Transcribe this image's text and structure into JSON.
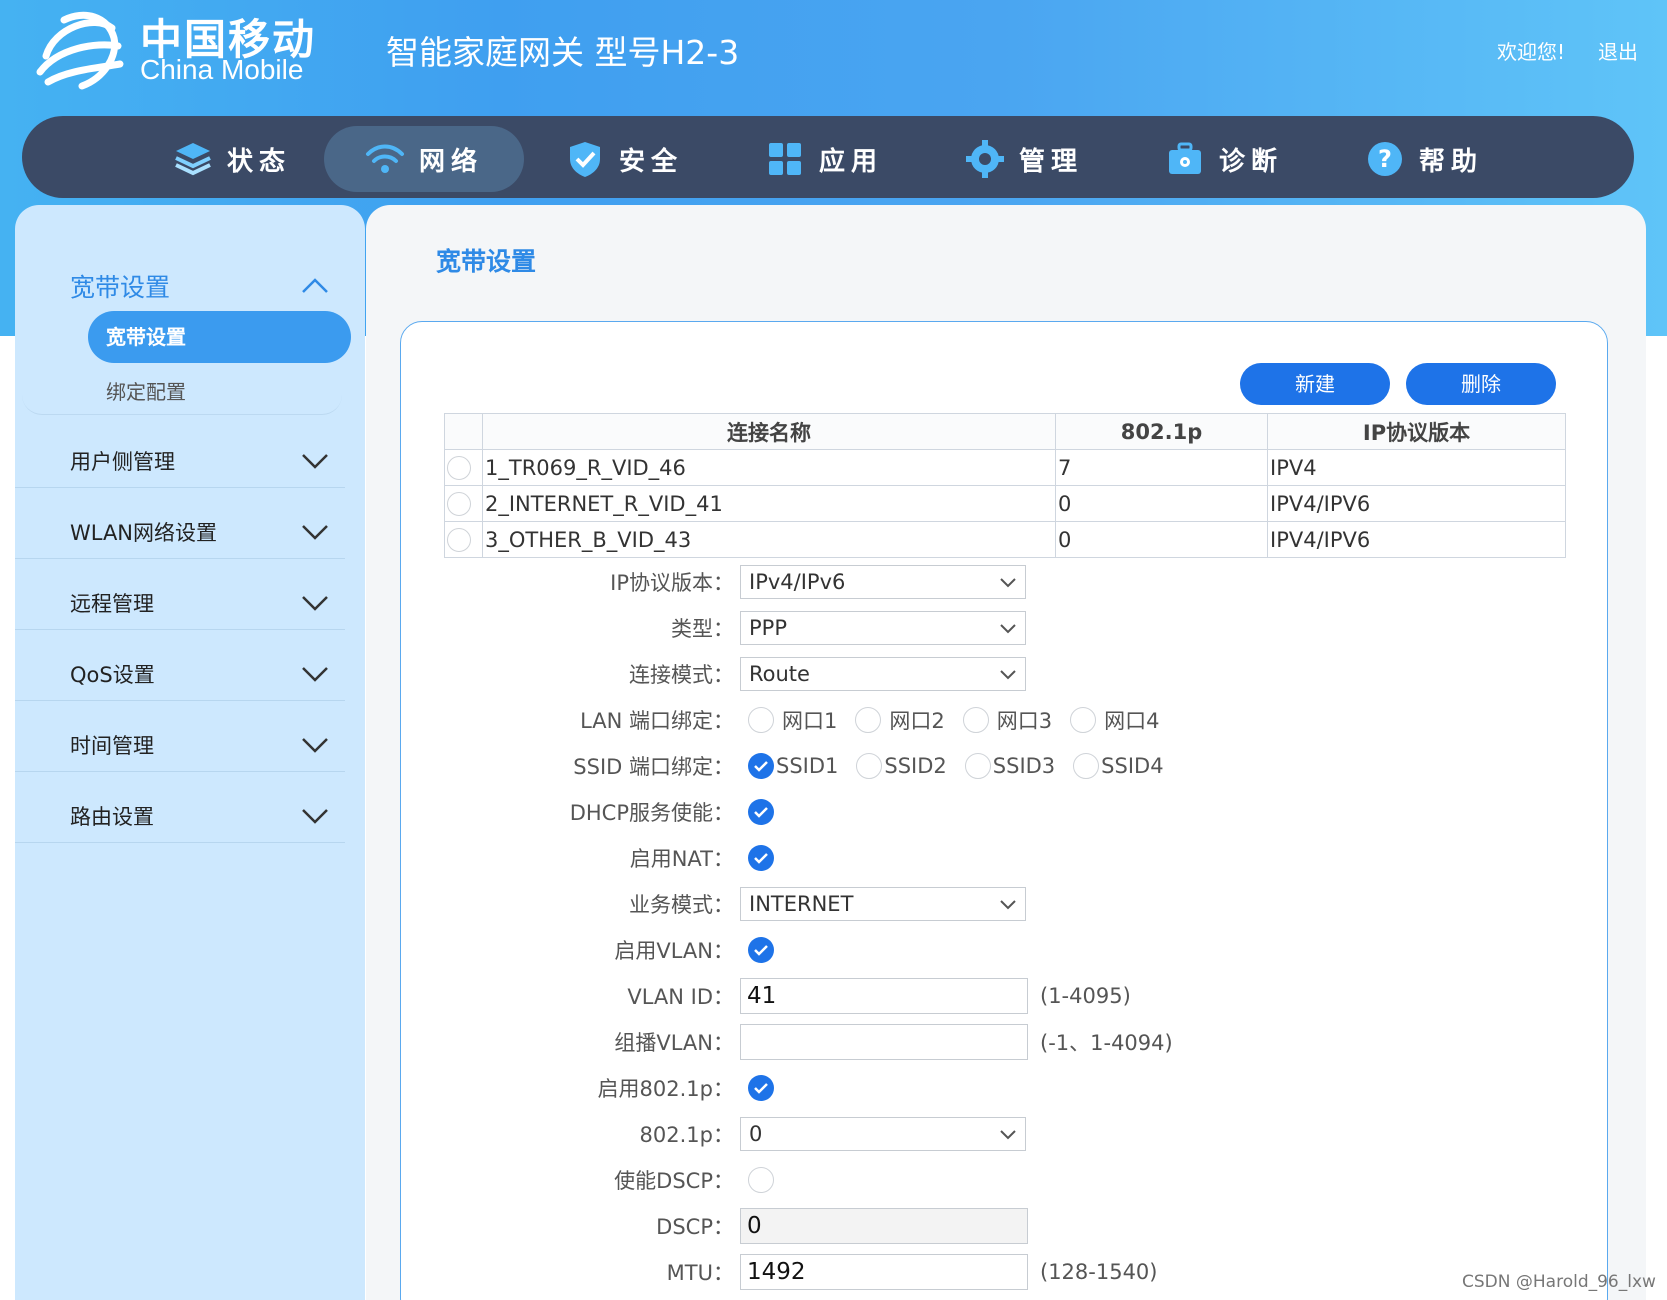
{
  "header": {
    "logo_cn": "中国移动",
    "logo_en": "China Mobile",
    "product": "智能家庭网关 型号H2-3",
    "welcome": "欢迎您!",
    "logout": "退出"
  },
  "nav": [
    {
      "label": "状态",
      "icon": "layers-icon"
    },
    {
      "label": "网络",
      "icon": "wifi-icon",
      "active": true
    },
    {
      "label": "安全",
      "icon": "shield-icon"
    },
    {
      "label": "应用",
      "icon": "grid-icon"
    },
    {
      "label": "管理",
      "icon": "gear-icon"
    },
    {
      "label": "诊断",
      "icon": "toolbox-icon"
    },
    {
      "label": "帮助",
      "icon": "help-icon"
    }
  ],
  "sidebar": {
    "open_group": "宽带设置",
    "sub_items": [
      "宽带设置",
      "绑定配置"
    ],
    "groups": [
      "用户侧管理",
      "WLAN网络设置",
      "远程管理",
      "QoS设置",
      "时间管理",
      "路由设置"
    ]
  },
  "main": {
    "title": "宽带设置",
    "new_button": "新建",
    "delete_button": "删除"
  },
  "table": {
    "headers": [
      "连接名称",
      "802.1p",
      "IP协议版本"
    ],
    "rows": [
      [
        "1_TR069_R_VID_46",
        "7",
        "IPV4"
      ],
      [
        "2_INTERNET_R_VID_41",
        "0",
        "IPV4/IPV6"
      ],
      [
        "3_OTHER_B_VID_43",
        "0",
        "IPV4/IPV6"
      ]
    ]
  },
  "form": {
    "ip_version": {
      "label": "IP协议版本：",
      "value": "IPv4/IPv6"
    },
    "type": {
      "label": "类型：",
      "value": "PPP"
    },
    "conn_mode": {
      "label": "连接模式：",
      "value": "Route"
    },
    "lan_bind": {
      "label": "LAN 端口绑定：",
      "options": [
        "网口1",
        "网口2",
        "网口3",
        "网口4"
      ]
    },
    "ssid_bind": {
      "label": "SSID 端口绑定：",
      "options": [
        "SSID1",
        "SSID2",
        "SSID3",
        "SSID4"
      ]
    },
    "dhcp": {
      "label": "DHCP服务使能："
    },
    "nat": {
      "label": "启用NAT："
    },
    "service_mode": {
      "label": "业务模式：",
      "value": "INTERNET"
    },
    "vlan_enable": {
      "label": "启用VLAN："
    },
    "vlan_id": {
      "label": "VLAN ID：",
      "value": "41",
      "hint": "(1-4095)"
    },
    "mcast_vlan": {
      "label": "组播VLAN：",
      "value": "",
      "hint": "(-1、1-4094)"
    },
    "p8021_enable": {
      "label": "启用802.1p："
    },
    "p8021": {
      "label": "802.1p：",
      "value": "0"
    },
    "dscp_enable": {
      "label": "使能DSCP："
    },
    "dscp": {
      "label": "DSCP：",
      "value": "0"
    },
    "mtu": {
      "label": "MTU：",
      "value": "1492",
      "hint": "(128-1540)"
    }
  },
  "watermark": "CSDN @Harold_96_lxw",
  "colors": {
    "accent": "#1e73e8",
    "nav_bg": "#3b4a66",
    "sidebar_bg": "#cde8fe",
    "title_blue": "#2f8ae6"
  }
}
